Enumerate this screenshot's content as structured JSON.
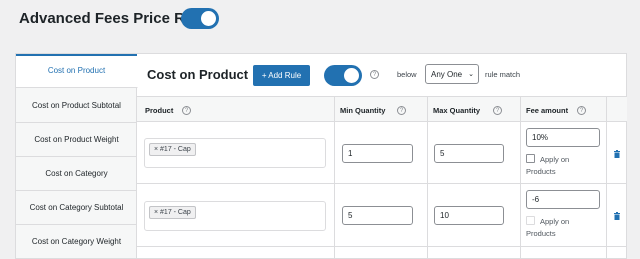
{
  "header": {
    "title": "Advanced Fees Price Rules",
    "toggle_on": true
  },
  "sidebar": {
    "items": [
      {
        "label": "Cost on Product",
        "active": true
      },
      {
        "label": "Cost on Product Subtotal"
      },
      {
        "label": "Cost on Product Weight"
      },
      {
        "label": "Cost on Category"
      },
      {
        "label": "Cost on Category Subtotal"
      },
      {
        "label": "Cost on Category Weight"
      }
    ]
  },
  "section": {
    "title": "Cost on Product",
    "add_button": "+ Add Rule",
    "toggle_on": true,
    "below_label": "below",
    "match_select": "Any One",
    "match_label": "rule match"
  },
  "table": {
    "headers": [
      "Product",
      "Min Quantity",
      "Max Quantity",
      "Fee amount"
    ],
    "rows": [
      {
        "product_tag": "× #17 - Cap",
        "min": "1",
        "max": "5",
        "fee": "10%",
        "apply_l1": "Apply on",
        "apply_l2": "Products"
      },
      {
        "product_tag": "× #17 - Cap",
        "min": "5",
        "max": "10",
        "fee": "-6",
        "apply_l1": "Apply on",
        "apply_l2": "Products"
      }
    ]
  },
  "colors": {
    "accent": "#2271b1",
    "border": "#dcdcde",
    "background": "#f0f0f1"
  },
  "icons": {
    "help": "help-circle-icon",
    "delete": "trash-icon",
    "dropdown": "chevron-down-icon"
  }
}
